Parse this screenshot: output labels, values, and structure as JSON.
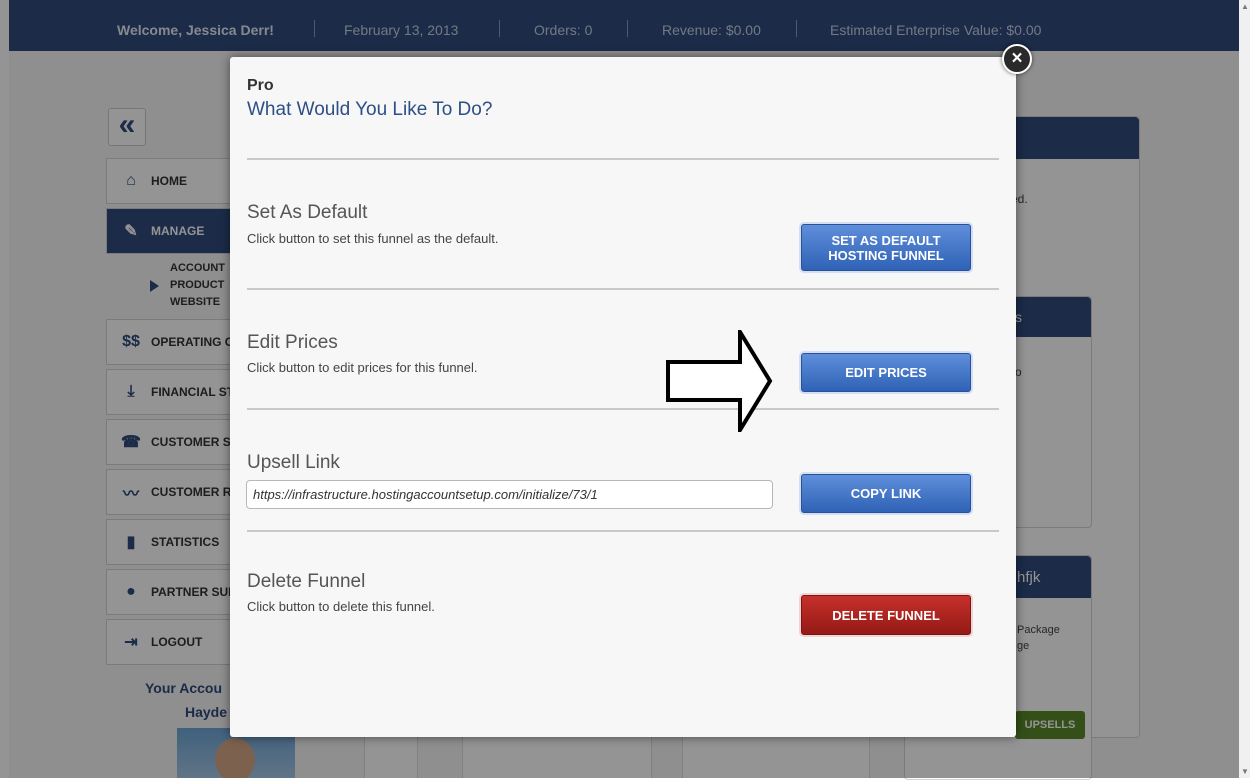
{
  "topbar": {
    "welcome": "Welcome, Jessica Derr!",
    "date": "February 13, 2013",
    "orders": "Orders: 0",
    "revenue": "Revenue: $0.00",
    "enterprise_value": "Estimated Enterprise Value: $0.00"
  },
  "sidebar": {
    "collapse_icon": "double-chevron-left-icon",
    "items": [
      {
        "label": "HOME",
        "icon": "house-icon"
      },
      {
        "label": "MANAGE",
        "icon": "wrench-icon"
      },
      {
        "label": "OPERATING C",
        "icon": "dollar-icon"
      },
      {
        "label": "FINANCIAL ST",
        "icon": "download-icon"
      },
      {
        "label": "CUSTOMER SU",
        "icon": "phone-icon"
      },
      {
        "label": "CUSTOMER RE",
        "icon": "trend-icon"
      },
      {
        "label": "STATISTICS",
        "icon": "bar-chart-icon"
      },
      {
        "label": "PARTNER SUP",
        "icon": "people-icon"
      },
      {
        "label": "LOGOUT",
        "icon": "logout-icon"
      }
    ],
    "sub_items": [
      "ACCOUNT",
      "PRODUCT",
      "WEBSITE"
    ],
    "your_account": "Your Accou",
    "account_name": "Hayde"
  },
  "background": {
    "text_d": "ed.",
    "text_s": "s",
    "text_o": "o",
    "panel_title": "hfjk",
    "package_line1": "Package",
    "package_line2": "ge",
    "upsells_button": "UPSELLS"
  },
  "modal": {
    "kicker": "Pro",
    "title": "What Would You Like To Do?",
    "close_icon": "close-icon",
    "sections": {
      "default": {
        "title": "Set As Default",
        "desc": "Click button to set this funnel as the default.",
        "button_line1": "SET AS DEFAULT",
        "button_line2": "HOSTING FUNNEL"
      },
      "prices": {
        "title": "Edit Prices",
        "desc": "Click button to edit prices for this funnel.",
        "button": "EDIT PRICES"
      },
      "upsell": {
        "title": "Upsell Link",
        "link": "https://infrastructure.hostingaccountsetup.com/initialize/73/1",
        "button": "COPY LINK"
      },
      "delete": {
        "title": "Delete Funnel",
        "desc": "Click button to delete this funnel.",
        "button": "DELETE FUNNEL"
      }
    }
  },
  "annotation": {
    "icon": "arrow-right-icon"
  },
  "colors": {
    "header_navy": "#2f4a7c",
    "title_blue": "#2c4f86",
    "button_blue": "#2f62b6",
    "button_red": "#951a16"
  }
}
